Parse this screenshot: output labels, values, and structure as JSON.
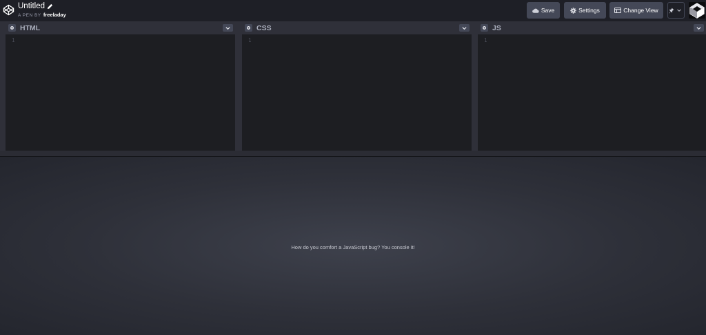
{
  "header": {
    "title": "Untitled",
    "byline_prefix": "A PEN BY",
    "username": "freeladay",
    "buttons": {
      "save": "Save",
      "settings": "Settings",
      "change_view": "Change View"
    }
  },
  "editors": [
    {
      "label": "HTML",
      "line": "1"
    },
    {
      "label": "CSS",
      "line": "1"
    },
    {
      "label": "JS",
      "line": "1"
    }
  ],
  "preview": {
    "text": "How do you comfort a JavaScript bug? You console it!"
  },
  "colors": {
    "background": "#1e1f26",
    "button": "#444857",
    "editor_bg": "#1d1e22",
    "editor_header": "#2f3039",
    "label_text": "#aaaebc"
  }
}
